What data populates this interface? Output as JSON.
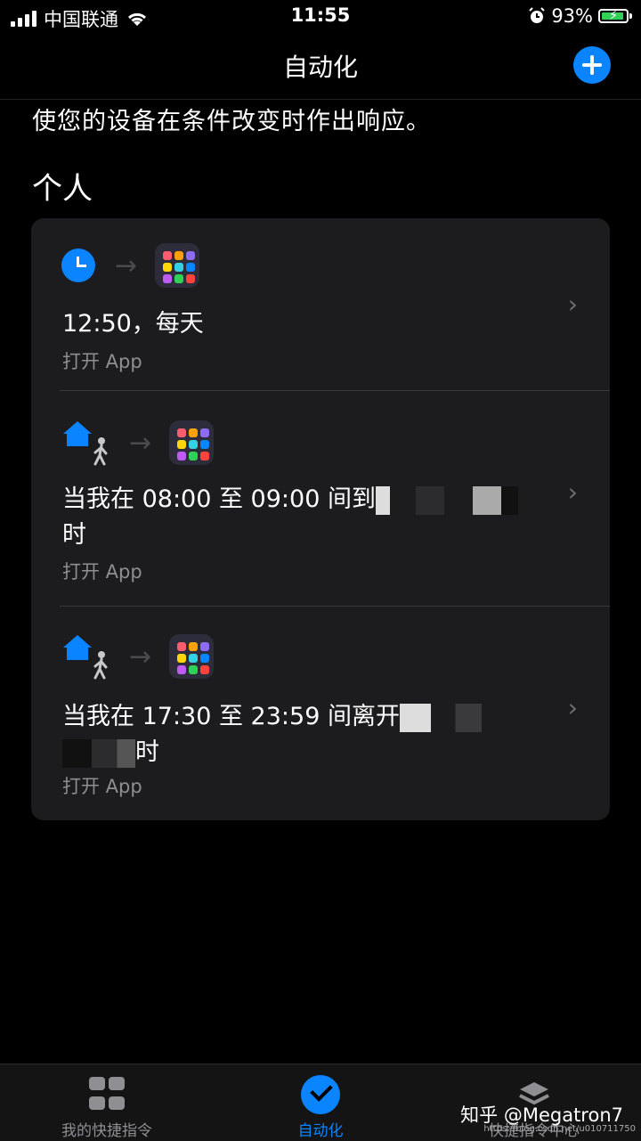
{
  "status_bar": {
    "carrier": "中国联通",
    "time": "11:55",
    "battery_percent": "93%",
    "battery_level": 0.93
  },
  "nav": {
    "title": "自动化"
  },
  "subtitle": "使您的设备在条件改变时作出响应。",
  "section_title": "个人",
  "automations": [
    {
      "title": "12:50，每天",
      "action": "打开 App",
      "trigger_icon": "clock-icon"
    },
    {
      "title_prefix": "当我在 08:00 至 09:00 间到",
      "title_suffix": "时",
      "action": "打开 App",
      "trigger_icon": "home-arrive-icon"
    },
    {
      "title_prefix": "当我在 17:30 至 23:59 间离开",
      "title_suffix": "时",
      "action": "打开 App",
      "trigger_icon": "home-leave-icon"
    }
  ],
  "tabs": [
    {
      "label": "我的快捷指令",
      "icon": "grid-icon"
    },
    {
      "label": "自动化",
      "icon": "checkmark-icon",
      "active": true
    },
    {
      "label": "快捷指令中心",
      "icon": "layers-icon"
    }
  ],
  "watermark": "知乎 @Megatron7",
  "watermark_small": "https://blog.csdn.net/u010711750",
  "colors": {
    "accent": "#0a84ff",
    "card": "#1c1c1e",
    "battery": "#31d158"
  }
}
